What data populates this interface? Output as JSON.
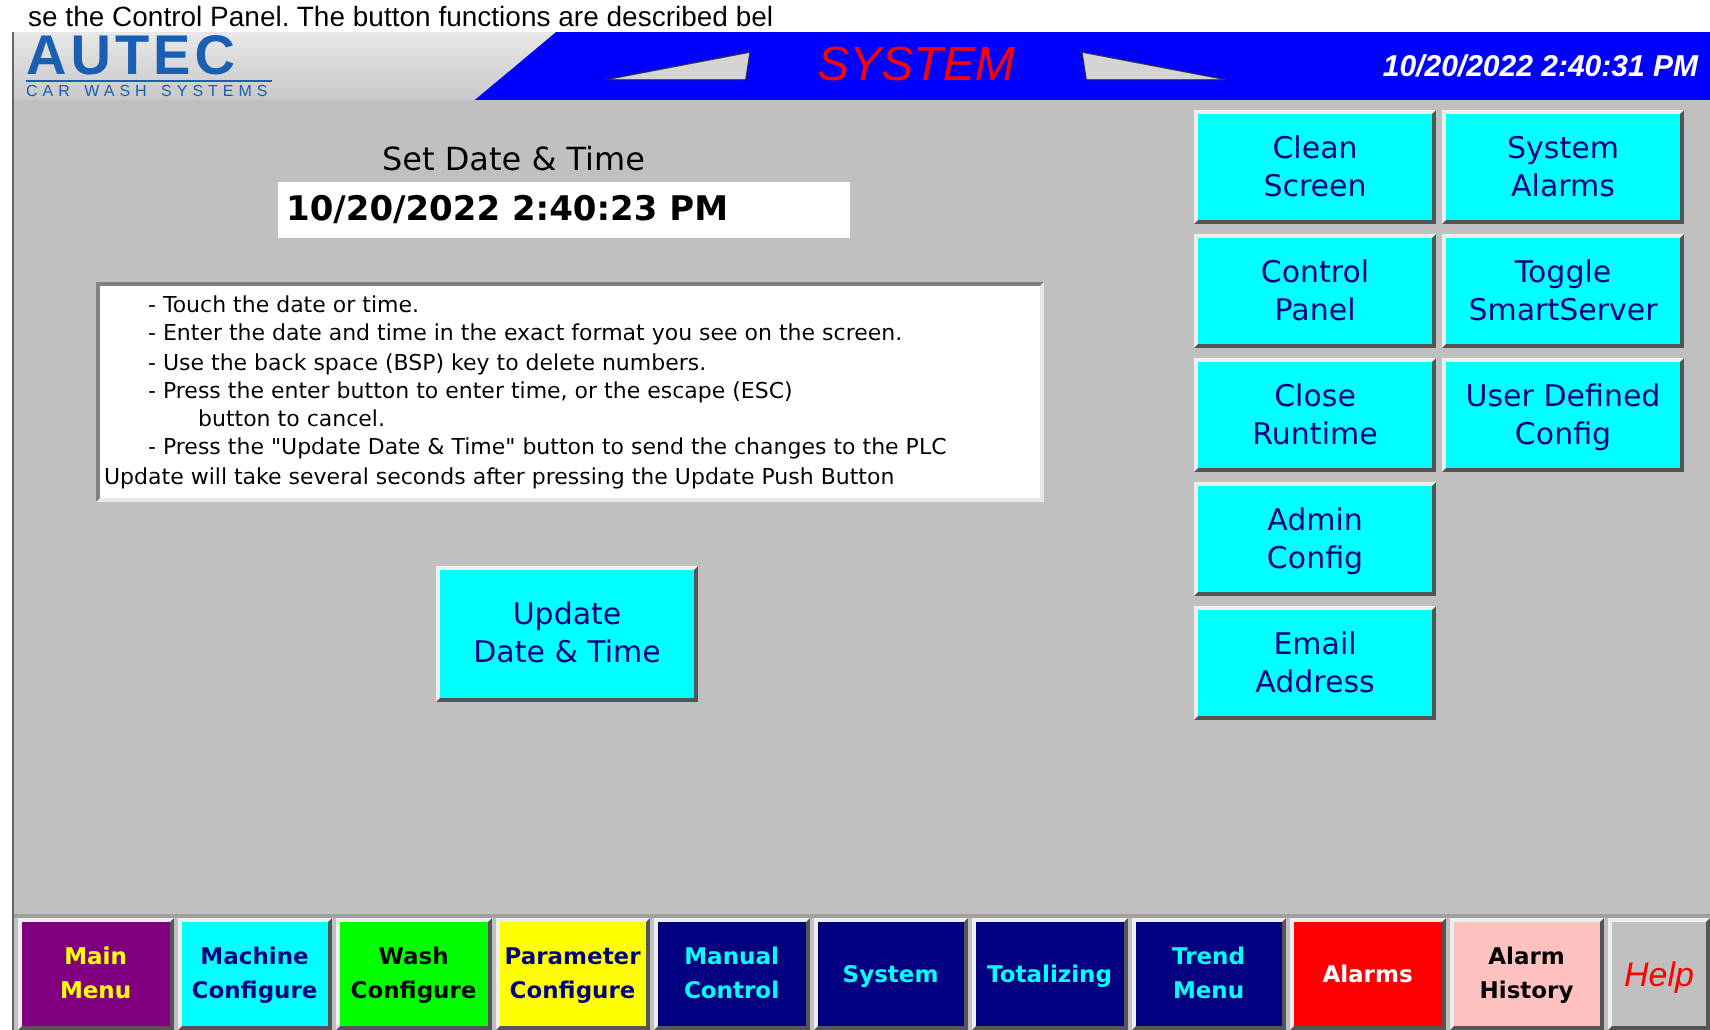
{
  "document_fragment": "se the Control Panel. The button functions are described bel",
  "header": {
    "logo": {
      "name": "AUTEC",
      "tagline": "CAR WASH SYSTEMS"
    },
    "title": "SYSTEM",
    "datetime": "10/20/2022 2:40:31 PM"
  },
  "date_setting": {
    "label": "Set Date & Time",
    "value": "10/20/2022 2:40:23 PM"
  },
  "instructions": [
    {
      "kind": "item",
      "text": "- Touch the date or time."
    },
    {
      "kind": "item",
      "text": "- Enter the date and time in the exact format you see on the screen."
    },
    {
      "kind": "item",
      "text": "- Use the back space (BSP) key to delete numbers."
    },
    {
      "kind": "item",
      "text": "- Press the enter button to enter time, or the escape (ESC)"
    },
    {
      "kind": "continuation",
      "text": "button to cancel."
    },
    {
      "kind": "item",
      "text": "- Press the \"Update Date & Time\" button to send the changes to the PLC"
    },
    {
      "kind": "note",
      "text": "Update will take several seconds after pressing the Update Push Button"
    }
  ],
  "update_button": [
    "Update",
    "Date & Time"
  ],
  "function_buttons": [
    [
      [
        "Clean",
        "Screen"
      ],
      [
        "System",
        "Alarms"
      ]
    ],
    [
      [
        "Control",
        "Panel"
      ],
      [
        "Toggle",
        "SmartServer"
      ]
    ],
    [
      [
        "Close",
        "Runtime"
      ],
      [
        "User Defined",
        "Config"
      ]
    ],
    [
      [
        "Admin",
        "Config"
      ]
    ],
    [
      [
        "Email",
        "Address"
      ]
    ]
  ],
  "nav": [
    {
      "kind": "tab",
      "lines": [
        "Main",
        "Menu"
      ],
      "color": "#800080"
    },
    {
      "kind": "tab",
      "lines": [
        "Machine",
        "Configure"
      ],
      "color": "#00ffff"
    },
    {
      "kind": "tab",
      "lines": [
        "Wash",
        "Configure"
      ],
      "color": "#00ff00"
    },
    {
      "kind": "tab",
      "lines": [
        "Parameter",
        "Configure"
      ],
      "color": "#ffff00"
    },
    {
      "kind": "tab",
      "lines": [
        "Manual",
        "Control"
      ],
      "color": "#000080"
    },
    {
      "kind": "tab",
      "lines": [
        "System"
      ],
      "color": "#000080"
    },
    {
      "kind": "tab",
      "lines": [
        "Totalizing"
      ],
      "color": "#000080"
    },
    {
      "kind": "tab",
      "lines": [
        "Trend",
        "Menu"
      ],
      "color": "#000080"
    },
    {
      "kind": "tab",
      "lines": [
        "Alarms"
      ],
      "color": "#ff0000"
    },
    {
      "kind": "tab",
      "lines": [
        "Alarm",
        "History"
      ],
      "color": "#ffc0c0"
    },
    {
      "kind": "help",
      "lines": [
        "Help"
      ],
      "color": "#c0c0c0"
    }
  ]
}
